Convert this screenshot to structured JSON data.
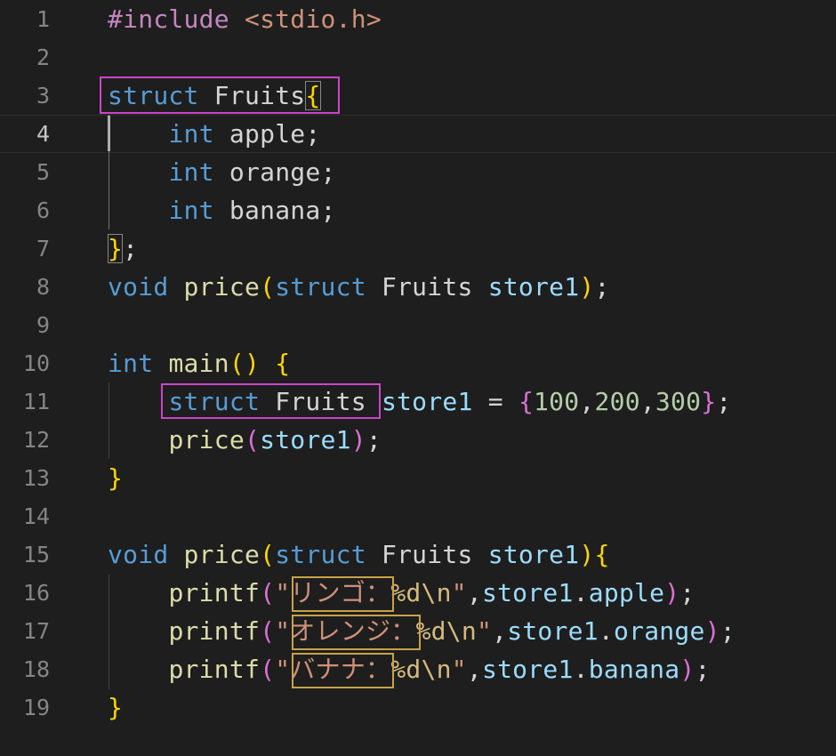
{
  "editor": {
    "lines": [
      {
        "n": "1",
        "tokens": [
          {
            "t": "#include",
            "c": "t-ctrl"
          },
          {
            "t": " "
          },
          {
            "t": "<stdio.h>",
            "c": "t-str"
          }
        ]
      },
      {
        "n": "2",
        "tokens": []
      },
      {
        "n": "3",
        "tokens": [
          {
            "t": "struct",
            "c": "t-kw"
          },
          {
            "t": " "
          },
          {
            "t": "Fruits",
            "c": "t-type"
          },
          {
            "t": "{",
            "c": "t-b1 brace-match"
          }
        ]
      },
      {
        "n": "4",
        "tokens": [
          {
            "t": "    "
          },
          {
            "t": "int",
            "c": "t-kw"
          },
          {
            "t": " apple;"
          }
        ]
      },
      {
        "n": "5",
        "tokens": [
          {
            "t": "    "
          },
          {
            "t": "int",
            "c": "t-kw"
          },
          {
            "t": " orange;"
          }
        ]
      },
      {
        "n": "6",
        "tokens": [
          {
            "t": "    "
          },
          {
            "t": "int",
            "c": "t-kw"
          },
          {
            "t": " banana;"
          }
        ]
      },
      {
        "n": "7",
        "tokens": [
          {
            "t": "}",
            "c": "t-b1 brace-match"
          },
          {
            "t": ";"
          }
        ]
      },
      {
        "n": "8",
        "tokens": [
          {
            "t": "void",
            "c": "t-kw"
          },
          {
            "t": " "
          },
          {
            "t": "price",
            "c": "t-func"
          },
          {
            "t": "(",
            "c": "t-b1"
          },
          {
            "t": "struct",
            "c": "t-kw"
          },
          {
            "t": " Fruits "
          },
          {
            "t": "store1",
            "c": "t-var"
          },
          {
            "t": ")",
            "c": "t-b1"
          },
          {
            "t": ";"
          }
        ]
      },
      {
        "n": "9",
        "tokens": []
      },
      {
        "n": "10",
        "tokens": [
          {
            "t": "int",
            "c": "t-kw"
          },
          {
            "t": " "
          },
          {
            "t": "main",
            "c": "t-func"
          },
          {
            "t": "()",
            "c": "t-b1"
          },
          {
            "t": " "
          },
          {
            "t": "{",
            "c": "t-b1"
          }
        ]
      },
      {
        "n": "11",
        "tokens": [
          {
            "t": "    "
          },
          {
            "t": "struct",
            "c": "t-kw"
          },
          {
            "t": " Fruits "
          },
          {
            "t": "store1",
            "c": "t-var"
          },
          {
            "t": " = "
          },
          {
            "t": "{",
            "c": "t-b2"
          },
          {
            "t": "100",
            "c": "t-num"
          },
          {
            "t": ","
          },
          {
            "t": "200",
            "c": "t-num"
          },
          {
            "t": ","
          },
          {
            "t": "300",
            "c": "t-num"
          },
          {
            "t": "}",
            "c": "t-b2"
          },
          {
            "t": ";"
          }
        ]
      },
      {
        "n": "12",
        "tokens": [
          {
            "t": "    "
          },
          {
            "t": "price",
            "c": "t-func"
          },
          {
            "t": "(",
            "c": "t-b2"
          },
          {
            "t": "store1",
            "c": "t-var"
          },
          {
            "t": ")",
            "c": "t-b2"
          },
          {
            "t": ";"
          }
        ]
      },
      {
        "n": "13",
        "tokens": [
          {
            "t": "}",
            "c": "t-b1"
          }
        ]
      },
      {
        "n": "14",
        "tokens": []
      },
      {
        "n": "15",
        "tokens": [
          {
            "t": "void",
            "c": "t-kw"
          },
          {
            "t": " "
          },
          {
            "t": "price",
            "c": "t-func"
          },
          {
            "t": "(",
            "c": "t-b1"
          },
          {
            "t": "struct",
            "c": "t-kw"
          },
          {
            "t": " Fruits "
          },
          {
            "t": "store1",
            "c": "t-var"
          },
          {
            "t": ")",
            "c": "t-b1"
          },
          {
            "t": "{",
            "c": "t-b1"
          }
        ]
      },
      {
        "n": "16",
        "tokens": [
          {
            "t": "    "
          },
          {
            "t": "printf",
            "c": "t-func"
          },
          {
            "t": "(",
            "c": "t-b2"
          },
          {
            "t": "\"リンゴ：",
            "c": "t-str"
          },
          {
            "t": "%d\\n",
            "c": "t-esc"
          },
          {
            "t": "\"",
            "c": "t-str"
          },
          {
            "t": ","
          },
          {
            "t": "store1",
            "c": "t-var"
          },
          {
            "t": "."
          },
          {
            "t": "apple",
            "c": "t-var"
          },
          {
            "t": ")",
            "c": "t-b2"
          },
          {
            "t": ";"
          }
        ]
      },
      {
        "n": "17",
        "tokens": [
          {
            "t": "    "
          },
          {
            "t": "printf",
            "c": "t-func"
          },
          {
            "t": "(",
            "c": "t-b2"
          },
          {
            "t": "\"オレンジ：",
            "c": "t-str"
          },
          {
            "t": "%d\\n",
            "c": "t-esc"
          },
          {
            "t": "\"",
            "c": "t-str"
          },
          {
            "t": ","
          },
          {
            "t": "store1",
            "c": "t-var"
          },
          {
            "t": "."
          },
          {
            "t": "orange",
            "c": "t-var"
          },
          {
            "t": ")",
            "c": "t-b2"
          },
          {
            "t": ";"
          }
        ]
      },
      {
        "n": "18",
        "tokens": [
          {
            "t": "    "
          },
          {
            "t": "printf",
            "c": "t-func"
          },
          {
            "t": "(",
            "c": "t-b2"
          },
          {
            "t": "\"バナナ：",
            "c": "t-str"
          },
          {
            "t": "%d\\n",
            "c": "t-esc"
          },
          {
            "t": "\"",
            "c": "t-str"
          },
          {
            "t": ","
          },
          {
            "t": "store1",
            "c": "t-var"
          },
          {
            "t": "."
          },
          {
            "t": "banana",
            "c": "t-var"
          },
          {
            "t": ")",
            "c": "t-b2"
          },
          {
            "t": ";"
          }
        ]
      },
      {
        "n": "19",
        "tokens": [
          {
            "t": "}",
            "c": "t-b1"
          }
        ]
      }
    ],
    "active_line": "4",
    "colors": {
      "background": "#1e1e1e",
      "keyword": "#569cd6",
      "function": "#dcdcaa",
      "variable": "#9cdcfe",
      "string": "#ce9178",
      "number": "#b5cea8",
      "bracket_gold": "#ffd700",
      "bracket_orchid": "#da70d6",
      "annotation_magenta": "#cc44cc",
      "annotation_gold": "#c8a24a"
    }
  }
}
